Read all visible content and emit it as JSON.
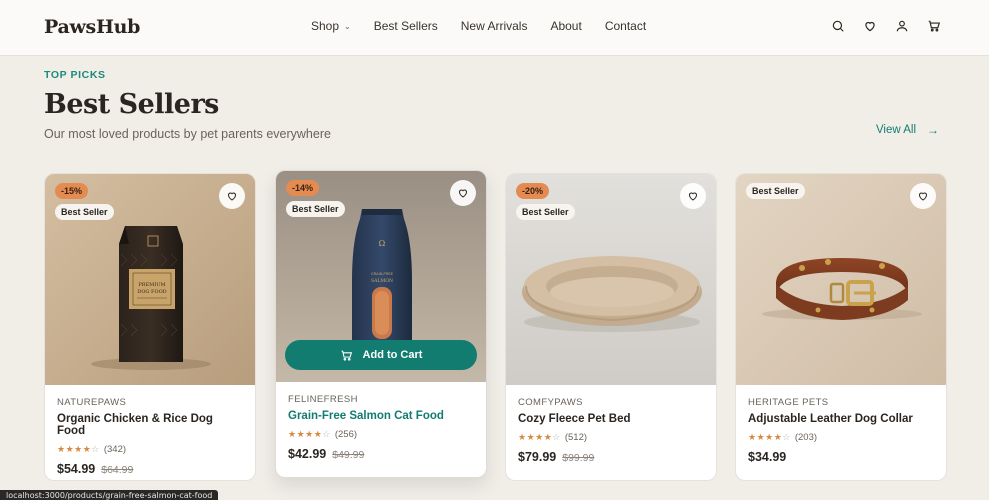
{
  "header": {
    "logo": "PawsHub",
    "nav": [
      {
        "label": "Shop",
        "has_dropdown": true
      },
      {
        "label": "Best Sellers"
      },
      {
        "label": "New Arrivals"
      },
      {
        "label": "About"
      },
      {
        "label": "Contact"
      }
    ],
    "icons": [
      "search-icon",
      "heart-icon",
      "user-icon",
      "cart-icon"
    ]
  },
  "section": {
    "eyebrow": "TOP PICKS",
    "title": "Best Sellers",
    "subtitle": "Our most loved products by pet parents everywhere",
    "view_all": "View All",
    "view_all_arrow": "→"
  },
  "products": [
    {
      "discount": "-15%",
      "badge": "Best Seller",
      "brand": "NATUREPAWS",
      "name": "Organic Chicken & Rice Dog Food",
      "stars": 4,
      "reviews": "(342)",
      "price": "$54.99",
      "old_price": "$64.99",
      "image": "dog-food-bag",
      "bag_text": "PREMIUM DOG FOOD"
    },
    {
      "discount": "-14%",
      "badge": "Best Seller",
      "brand": "FELINEFRESH",
      "name": "Grain-Free Salmon Cat Food",
      "stars": 4,
      "reviews": "(256)",
      "price": "$42.99",
      "old_price": "$49.99",
      "image": "cat-food-bag",
      "bag_text": "GRAIN-FREE SALMON",
      "add_to_cart": "Add to Cart"
    },
    {
      "discount": "-20%",
      "badge": "Best Seller",
      "brand": "COMFYPAWS",
      "name": "Cozy Fleece Pet Bed",
      "stars": 4,
      "reviews": "(512)",
      "price": "$79.99",
      "old_price": "$99.99",
      "image": "pet-bed"
    },
    {
      "badge": "Best Seller",
      "brand": "HERITAGE PETS",
      "name": "Adjustable Leather Dog Collar",
      "stars": 4,
      "reviews": "(203)",
      "price": "$34.99",
      "image": "leather-collar"
    }
  ],
  "status_bar": {
    "url": "localhost:3000/products/grain-free-salmon-cat-food"
  },
  "colors": {
    "accent": "#137c70",
    "discount_badge": "#e48b52",
    "star": "#d9893f",
    "page_bg": "#f1eee8"
  }
}
